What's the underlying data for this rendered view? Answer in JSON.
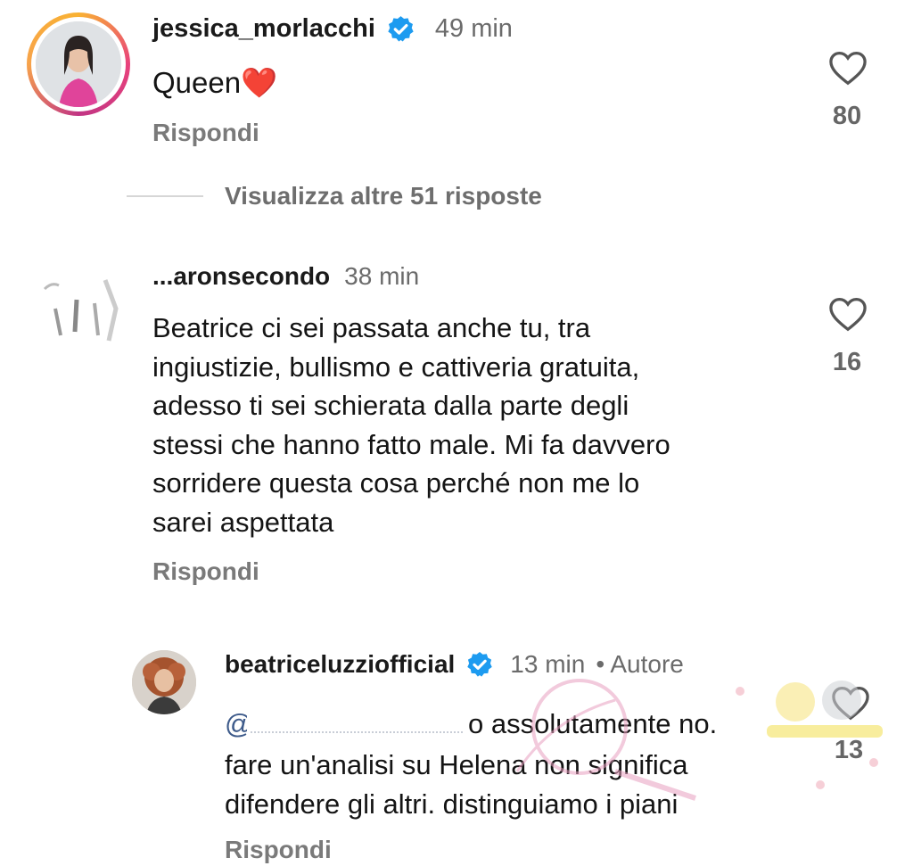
{
  "comments": [
    {
      "username": "jessica_morlacchi",
      "verified": true,
      "time": "49 min",
      "text": "Queen❤️",
      "reply_label": "Rispondi",
      "likes": "80"
    },
    {
      "username": "...aronsecondo",
      "verified": false,
      "time": "38 min",
      "text": "Beatrice ci sei passata anche tu, tra ingiustizie, bullismo e cattiveria gratuita, adesso ti sei schierata dalla parte degli stessi che hanno fatto male. Mi fa davvero sorridere questa cosa perché non me lo sarei aspettata",
      "lines": [
        "Beatrice ci sei passata anche tu, tra",
        "ingiustizie, bullismo e cattiveria gratuita,",
        "adesso ti sei schierata dalla parte degli",
        "stessi che hanno fatto male. Mi fa davvero",
        "sorridere questa cosa perché non me lo",
        "sarei aspettata"
      ],
      "reply_label": "Rispondi",
      "likes": "16"
    }
  ],
  "view_more": "Visualizza altre 51 risposte",
  "reply": {
    "username": "beatriceluzziofficial",
    "verified": true,
    "time": "13 min",
    "author_label": "• Autore",
    "mention": "@",
    "lines": [
      "o assolutamente no.",
      "fare un'analisi su Helena non significa",
      "difendere gli altri. distinguiamo i piani"
    ],
    "reply_label": "Rispondi",
    "likes": "13"
  },
  "colors": {
    "verified": "#1d9bf0",
    "muted": "#7a7a7a",
    "watermark": "#e8a0c0"
  },
  "icons": [
    "heart-icon",
    "verified-badge-icon"
  ]
}
